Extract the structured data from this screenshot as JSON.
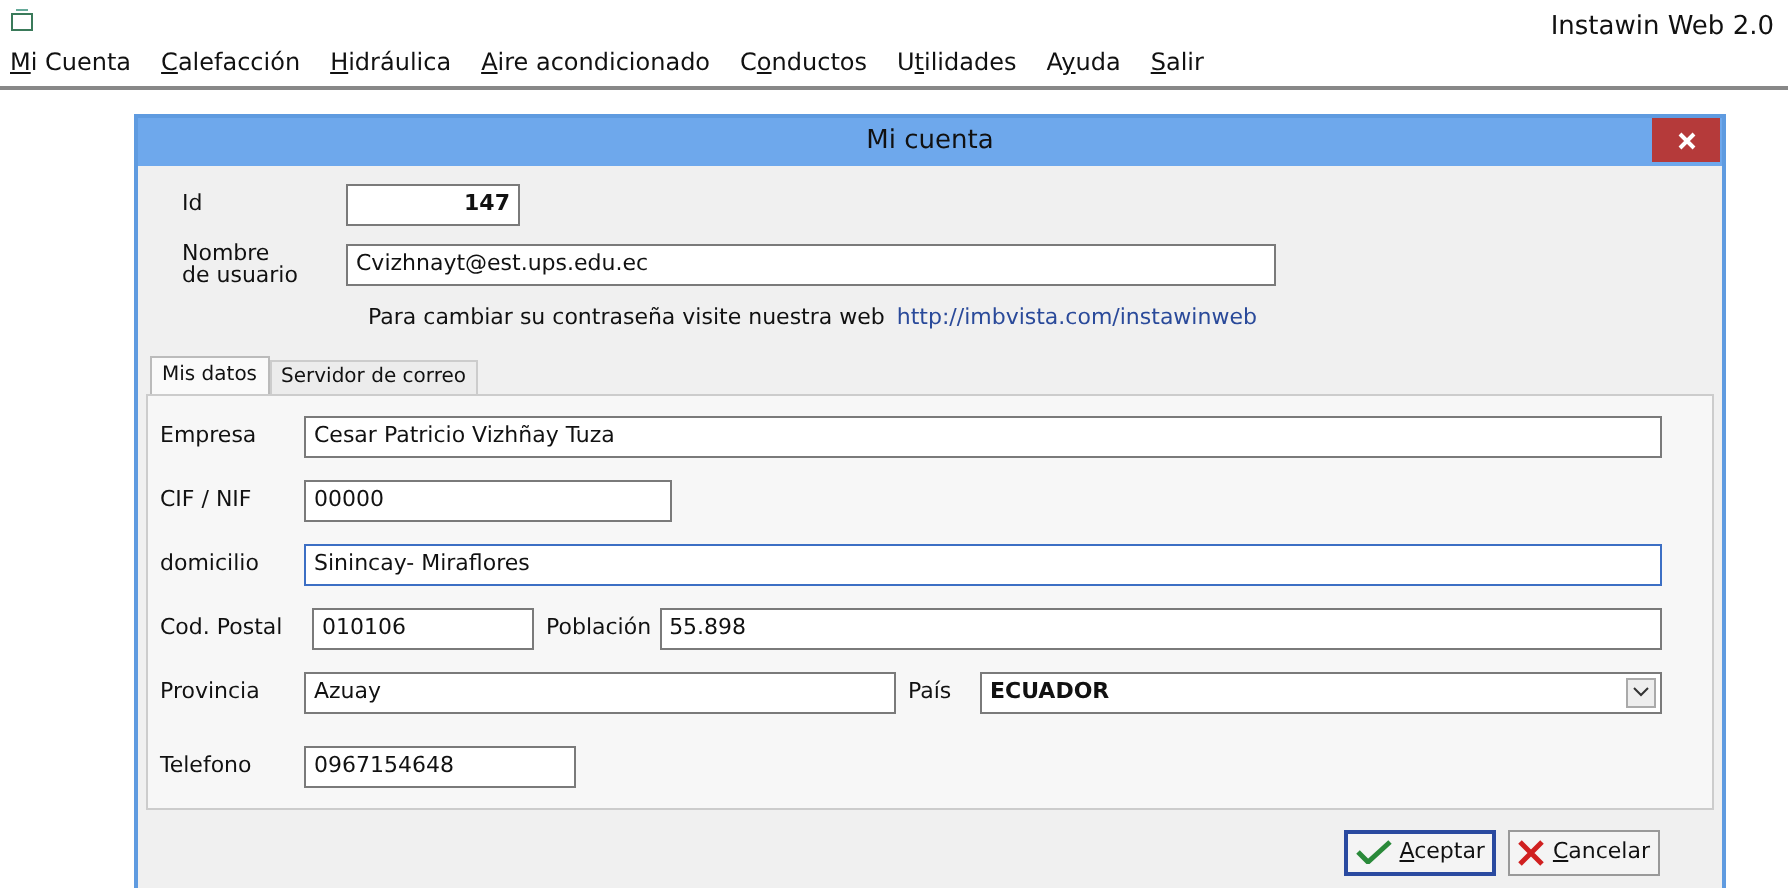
{
  "app_title": "Instawin Web 2.0",
  "menu": [
    {
      "key": "M",
      "post": "i Cuenta"
    },
    {
      "key": "C",
      "post": "alefacción"
    },
    {
      "key": "H",
      "post": "idráulica"
    },
    {
      "key": "A",
      "post": "ire acondicionado"
    },
    {
      "pre": "C",
      "key": "o",
      "post": "nductos"
    },
    {
      "pre": "U",
      "key": "t",
      "post": "ilidades"
    },
    {
      "pre": "A",
      "key": "y",
      "post": "uda"
    },
    {
      "key": "S",
      "post": "alir"
    }
  ],
  "dialog": {
    "title": "Mi cuenta",
    "id": {
      "label": "Id",
      "value": "147"
    },
    "username": {
      "label": "Nombre de usuario",
      "value": "Cvizhnayt@est.ups.edu.ec"
    },
    "info": {
      "text": "Para cambiar su contraseña visite nuestra web",
      "link": "http://imbvista.com/instawinweb"
    },
    "tabs": [
      {
        "label": "Mis datos",
        "selected": true
      },
      {
        "label": "Servidor de correo",
        "selected": false
      }
    ],
    "rows": [
      [
        {
          "kind": "text",
          "label": "Empresa",
          "value": "Cesar Patricio Vizhñay Tuza"
        }
      ],
      [
        {
          "kind": "text",
          "label": "CIF / NIF",
          "value": "00000"
        }
      ],
      [
        {
          "kind": "text",
          "label": "domicilio",
          "value": "Sinincay- Miraflores",
          "focused": true
        }
      ],
      [
        {
          "kind": "text",
          "label": "Cod. Postal",
          "value": "010106"
        },
        {
          "kind": "text",
          "label": "Población",
          "value": "55.898"
        }
      ],
      [
        {
          "kind": "text",
          "label": "Provincia",
          "value": "Azuay"
        },
        {
          "kind": "select",
          "label": "País",
          "value": "ECUADOR"
        }
      ],
      [
        {
          "kind": "text",
          "label": "Telefono",
          "value": "0967154648"
        }
      ]
    ],
    "buttons": [
      {
        "kind": "ok",
        "key": "A",
        "post": "ceptar",
        "default": true
      },
      {
        "kind": "cancel",
        "key": "C",
        "post": "ancelar",
        "default": false
      }
    ]
  }
}
